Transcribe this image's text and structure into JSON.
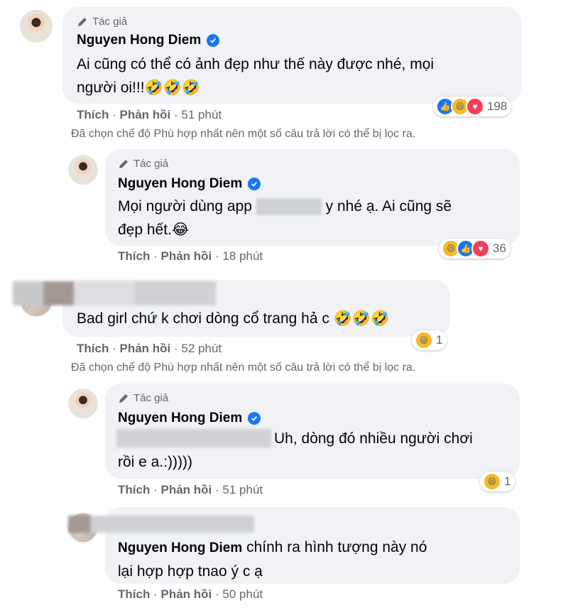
{
  "comments": [
    {
      "author_tag": "Tác giả",
      "author": "Nguyen Hong Diem",
      "text_line1": "Ai cũng có thể có ảnh đẹp như thế này được nhé, mọi",
      "text_line2": "người oi!!!🤣🤣🤣",
      "like": "Thích",
      "reply": "Phản hồi",
      "time": "51 phút",
      "reaction_count": "198"
    },
    {
      "author_tag": "Tác giả",
      "author": "Nguyen Hong Diem",
      "text_line1_a": "Mọi người dùng app",
      "text_line1_b": "y nhé ạ. Ai cũng sẽ",
      "text_line2": "đẹp hết.😂",
      "like": "Thích",
      "reply": "Phản hồi",
      "time": "18 phút",
      "reaction_count": "36"
    },
    {
      "text": "Bad girl chứ k chơi dòng cổ trang hả c 🤣🤣🤣",
      "like": "Thích",
      "reply": "Phản hồi",
      "time": "52 phút",
      "reaction_count": "1"
    },
    {
      "author_tag": "Tác giả",
      "author": "Nguyen Hong Diem",
      "text_line1": "Uh, dòng đó nhiều người chơi",
      "text_line2": "rồi e a.:)))))",
      "like": "Thích",
      "reply": "Phản hồi",
      "time": "51 phút",
      "reaction_count": "1"
    },
    {
      "author": "Nguyen Hong Diem",
      "text_line1": "chính ra hình tượng này nó",
      "text_line2": "lại hợp hợp tnao ý c ạ",
      "like": "Thích",
      "reply": "Phản hồi",
      "time": "50 phút"
    }
  ],
  "filter_notice": "Đã chọn chế độ Phù hợp nhất nên một số câu trả lời có thể bị lọc ra.",
  "separator": "·",
  "icons": {
    "pen": "pen-icon",
    "verified": "verified-badge-icon",
    "like": "like-reaction-icon",
    "haha": "haha-reaction-icon",
    "love": "love-reaction-icon"
  },
  "colors": {
    "bubble": "#f0f2f5",
    "meta": "#65676b",
    "verified": "#1877f2",
    "haha": "#f7b928",
    "love": "#f33e58"
  }
}
